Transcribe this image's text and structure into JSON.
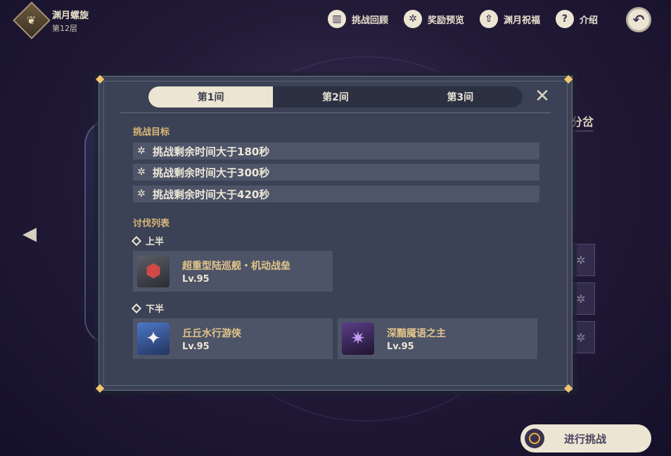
{
  "header": {
    "title": "渊月螺旋",
    "floor": "第12层",
    "emblem_icon": "tree-emblem-icon"
  },
  "nav": [
    {
      "label": "挑战回顾",
      "icon": "book-icon",
      "glyph": "▥"
    },
    {
      "label": "奖励预览",
      "icon": "star-badge-icon",
      "glyph": "✲"
    },
    {
      "label": "渊月祝福",
      "icon": "upload-icon",
      "glyph": "⇧"
    },
    {
      "label": "介绍",
      "icon": "help-icon",
      "glyph": "?"
    }
  ],
  "back_button": {
    "icon": "return-icon",
    "glyph": "↶"
  },
  "background": {
    "label": "分岔"
  },
  "modal": {
    "tabs": [
      "第1间",
      "第2间",
      "第3间"
    ],
    "active_tab": 0,
    "close_glyph": "✕",
    "goals_title": "挑战目标",
    "goals": [
      "挑战剩余时间大于180秒",
      "挑战剩余时间大于300秒",
      "挑战剩余时间大于420秒"
    ],
    "enemies_title": "讨伐列表",
    "first_half_label": "上半",
    "second_half_label": "下半",
    "first_half": [
      {
        "name": "超重型陆巡舰・机动战垒",
        "level": "Lv.95"
      }
    ],
    "second_half": [
      {
        "name": "丘丘水行游侠",
        "level": "Lv.95"
      },
      {
        "name": "深黯魇语之主",
        "level": "Lv.95"
      }
    ]
  },
  "start_button": {
    "label": "进行挑战"
  },
  "colors": {
    "accent_gold": "#d9b877",
    "panel": "#3b4255",
    "cream": "#ece5d3",
    "bg_dark": "#1b1530"
  }
}
